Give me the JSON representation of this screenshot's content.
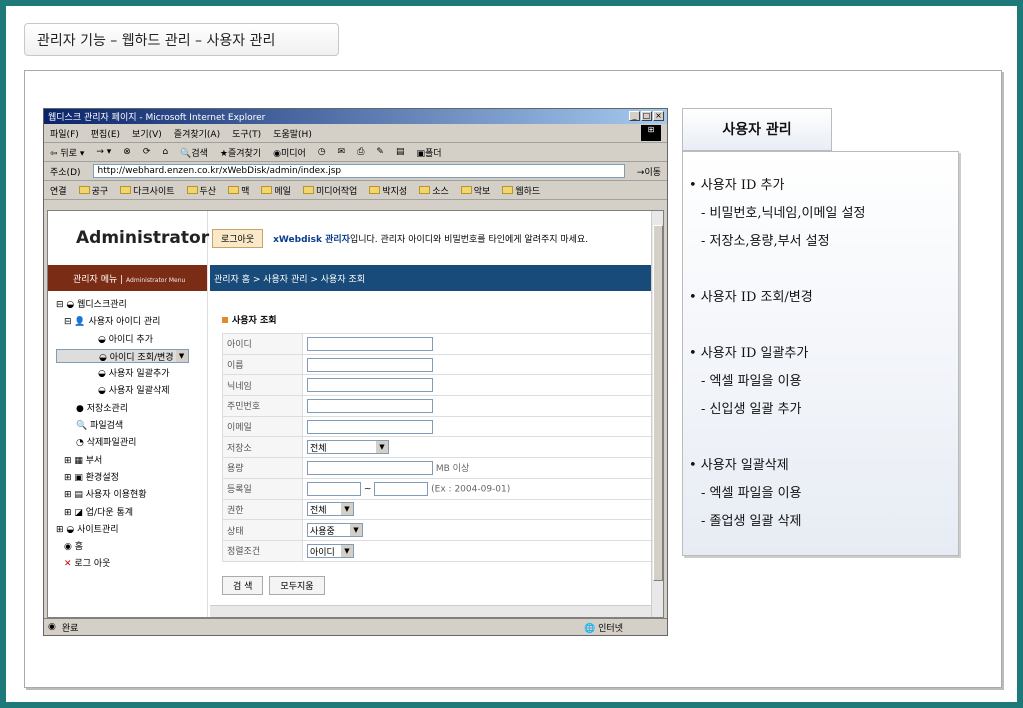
{
  "page_title": "관리자 기능 – 웹하드 관리 – 사용자 관리",
  "ie": {
    "title": "웹디스크 관리자 페이지 - Microsoft Internet Explorer",
    "menu": [
      "파일(F)",
      "편집(E)",
      "보기(V)",
      "즐겨찾기(A)",
      "도구(T)",
      "도움말(H)"
    ],
    "toolbar": [
      "뒤로 ▾",
      "→ ▾",
      "검색",
      "즐겨찾기",
      "미디어",
      "폴더"
    ],
    "address_label": "주소(D)",
    "address": "http://webhard.enzen.co.kr/xWebDisk/admin/index.jsp",
    "go": "이동",
    "links_label": "연결",
    "links": [
      "공구",
      "다크사이트",
      "두산",
      "맥",
      "메일",
      "미디어작업",
      "박지성",
      "소스",
      "악보",
      "웹하드"
    ],
    "status_left": "완료",
    "status_right": "인터넷"
  },
  "site": {
    "logo": "Administrator",
    "logout": "로그아웃",
    "notice_brand": "xWebdisk 관리자",
    "notice_rest": "입니다. 관리자 아이디와 비밀번호를 타인에게 알려주지 마세요.",
    "menu_title": "관리자 메뉴",
    "menu_sub": "Administrator Menu",
    "breadcrumb": "관리자 홈 > 사용자 관리 > 사용자 조회",
    "tree": [
      "웹디스크관리",
      "사용자 아이디 관리",
      "아이디 추가",
      "아이디 조회/변경",
      "사용자 일괄추가",
      "사용자 일괄삭제",
      "저장소관리",
      "파일검색",
      "삭제파일관리",
      "부서",
      "환경설정",
      "사용자 이용현황",
      "업/다운 통계",
      "사이트관리",
      "홈",
      "로그 아웃"
    ],
    "section": "사용자 조회",
    "labels": [
      "아이디",
      "이름",
      "닉네임",
      "주민번호",
      "이메일",
      "저장소",
      "용량",
      "등록일",
      "권한",
      "상태",
      "정렬조건"
    ],
    "storage_sel": "전체",
    "capacity_unit": "MB 이상",
    "date_sep": "~",
    "date_hint": "(Ex : 2004-09-01)",
    "role_sel": "전체",
    "status_sel": "사용중",
    "sort_sel": "아이디",
    "search_btn": "검  색",
    "clear_btn": "모두지움"
  },
  "right": {
    "tab": "사용자 관리",
    "items": [
      {
        "t": "• 사용자 ID 추가",
        "sub": [
          "- 비밀번호,닉네임,이메일 설정",
          "- 저장소,용량,부서 설정"
        ]
      },
      {
        "t": "• 사용자 ID 조회/변경",
        "sub": []
      },
      {
        "t": "• 사용자 ID 일괄추가",
        "sub": [
          "- 엑셀 파일을 이용",
          "- 신입생 일괄 추가"
        ]
      },
      {
        "t": "• 사용자 일괄삭제",
        "sub": [
          "- 엑셀 파일을 이용",
          "- 졸업생 일괄 삭제"
        ]
      }
    ]
  }
}
